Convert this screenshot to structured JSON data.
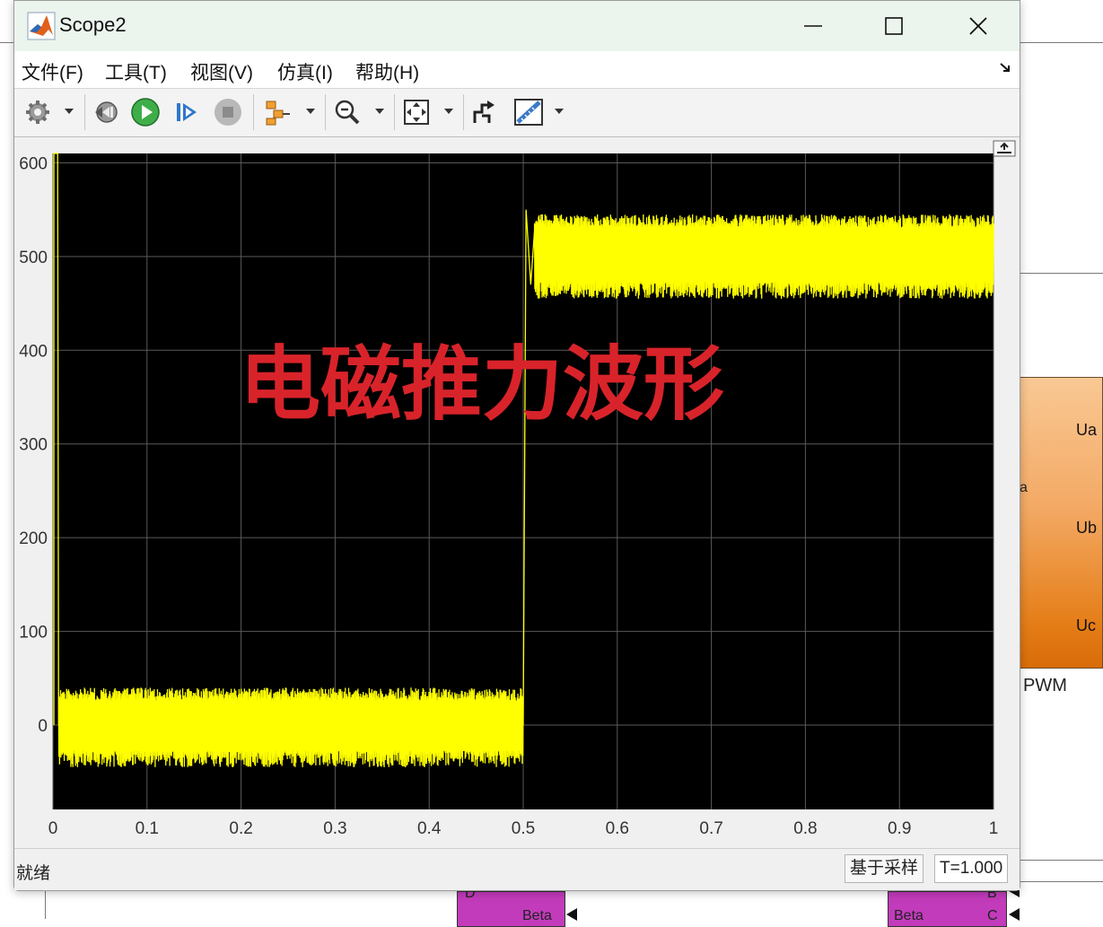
{
  "window": {
    "title": "Scope2",
    "menu": [
      "文件(F)",
      "工具(T)",
      "视图(V)",
      "仿真(I)",
      "帮助(H)"
    ]
  },
  "toolbar": {
    "buttons": [
      "gear-icon",
      "step-back-icon",
      "run-icon",
      "step-forward-icon",
      "stop-icon",
      "signal-select-icon",
      "zoom-icon",
      "autoscale-icon",
      "highlight-icon",
      "measure-icon"
    ]
  },
  "status": {
    "left": "就绪",
    "mode": "基于采样",
    "time": "T=1.000"
  },
  "overlay_text": "电磁推力波形",
  "background": {
    "ports": [
      "Ua",
      "Ub",
      "Uc"
    ],
    "fragment_a": "a",
    "pwm_label": "PWM",
    "block_labels": [
      "D",
      "Beta",
      "B",
      "Beta",
      "C"
    ]
  },
  "colors": {
    "plot_bg": "#000000",
    "trace": "#ffff00",
    "overlay": "#d9232a",
    "grid": "#5a5a5a"
  },
  "chart_data": {
    "type": "line",
    "xlim": [
      0,
      1
    ],
    "ylim": [
      -90,
      610
    ],
    "xticks": [
      "0",
      "0.1",
      "0.2",
      "0.3",
      "0.4",
      "0.5",
      "0.6",
      "0.7",
      "0.8",
      "0.9",
      "1"
    ],
    "yticks": [
      "600",
      "500",
      "400",
      "300",
      "200",
      "100",
      "0"
    ],
    "grid": true,
    "series": [
      {
        "segments": [
          {
            "x_start": 0.0,
            "x_end": 0.0,
            "y_low": 0,
            "y_high": 610
          },
          {
            "x_start": 0.006,
            "x_end": 0.5,
            "center": 0,
            "band": [
              -45,
              40
            ]
          },
          {
            "x_start": 0.5,
            "x_end": 0.503,
            "rise_to": 550
          },
          {
            "x_start": 0.505,
            "x_end": 1.0,
            "center": 500,
            "band": [
              455,
              545
            ]
          }
        ]
      }
    ]
  }
}
